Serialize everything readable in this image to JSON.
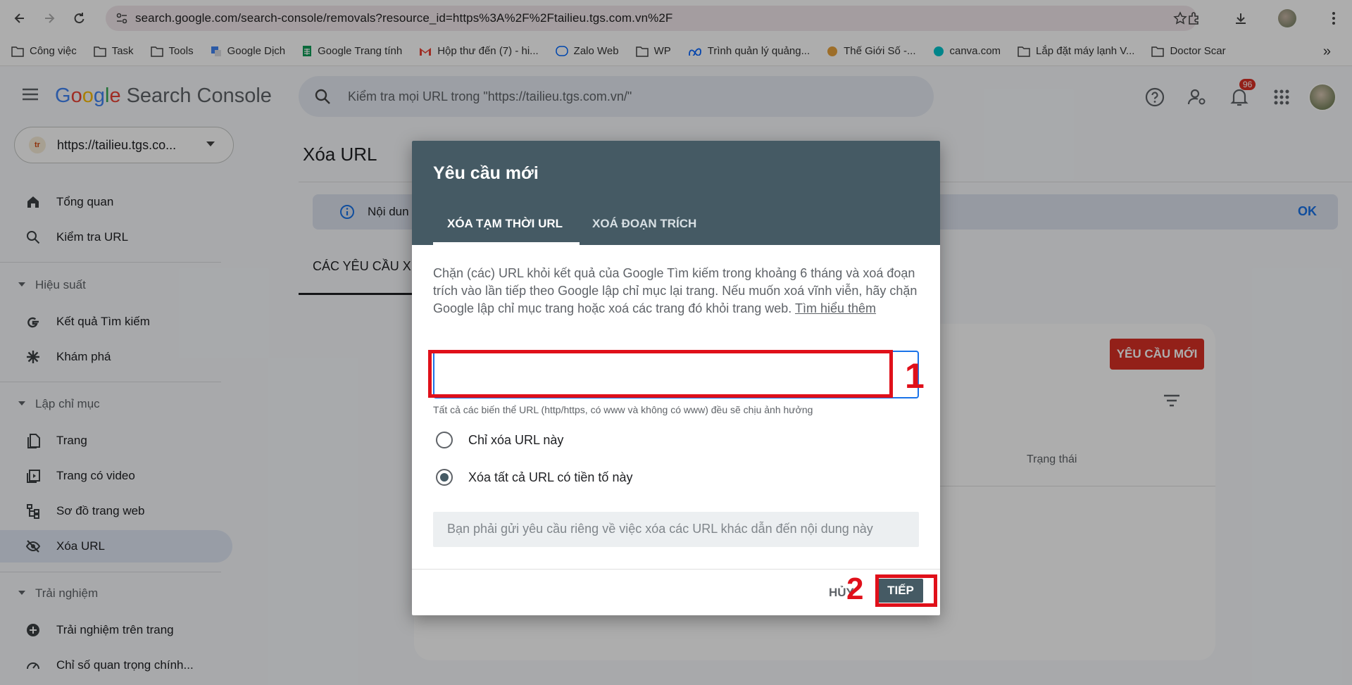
{
  "browser": {
    "url": "search.google.com/search-console/removals?resource_id=https%3A%2F%2Ftailieu.tgs.com.vn%2F",
    "bookmarks": [
      {
        "label": "Công việc",
        "icon": "folder-icon"
      },
      {
        "label": "Task",
        "icon": "folder-icon"
      },
      {
        "label": "Tools",
        "icon": "folder-icon"
      },
      {
        "label": "Google Dịch",
        "icon": "google-translate-icon"
      },
      {
        "label": "Google Trang tính",
        "icon": "google-sheets-icon"
      },
      {
        "label": "Hộp thư đến (7) - hi...",
        "icon": "gmail-icon"
      },
      {
        "label": "Zalo Web",
        "icon": "zalo-icon"
      },
      {
        "label": "WP",
        "icon": "folder-icon"
      },
      {
        "label": "Trình quản lý quảng...",
        "icon": "meta-icon"
      },
      {
        "label": "Thế Giới Số -...",
        "icon": "site-icon"
      },
      {
        "label": "canva.com",
        "icon": "canva-icon"
      },
      {
        "label": "Lắp đặt máy lạnh V...",
        "icon": "folder-icon"
      },
      {
        "label": "Doctor Scar",
        "icon": "folder-icon"
      }
    ],
    "more": "»"
  },
  "app": {
    "logo_google": [
      "G",
      "o",
      "o",
      "g",
      "l",
      "e"
    ],
    "logo_product": "Search Console",
    "search_placeholder": "Kiểm tra mọi URL trong \"https://tailieu.tgs.com.vn/\"",
    "notification_count": "96"
  },
  "sidebar": {
    "property": "https://tailieu.tgs.co...",
    "items": {
      "overview": "Tổng quan",
      "url_inspection": "Kiểm tra URL",
      "performance_section": "Hiệu suất",
      "search_results": "Kết quả Tìm kiếm",
      "discover": "Khám phá",
      "indexing_section": "Lập chỉ mục",
      "pages": "Trang",
      "video_pages": "Trang có video",
      "sitemaps": "Sơ đồ trang web",
      "removals": "Xóa URL",
      "experience_section": "Trải nghiệm",
      "page_experience": "Trải nghiệm trên trang",
      "core_web_vitals": "Chỉ số quan trọng chính..."
    }
  },
  "main": {
    "title": "Xóa URL",
    "info_text": "Nội dun",
    "info_ok": "OK",
    "requests_tab": "CÁC YÊU CẦU X",
    "new_request": "YÊU CẦU MỚI",
    "status_header": "Trạng thái"
  },
  "dialog": {
    "title": "Yêu cầu mới",
    "tab_temp": "XÓA TẠM THỜI URL",
    "tab_snippet": "XOÁ ĐOẠN TRÍCH",
    "description": "Chặn (các) URL khỏi kết quả của Google Tìm kiếm trong khoảng 6 tháng và xoá đoạn trích vào lần tiếp theo Google lập chỉ mục lại trang. Nếu muốn xoá vĩnh viễn, hãy chặn Google lập chỉ mục trang hoặc xoá các trang đó khỏi trang web.",
    "learn_more": "Tìm hiểu thêm",
    "url_value": "",
    "hint": "Tất cả các biến thể URL (http/https, có www và không có www) đều sẽ chịu ảnh hưởng",
    "option_this_url": "Chỉ xóa URL này",
    "option_prefix": "Xóa tất cả URL có tiền tố này",
    "selected_option": "option_prefix",
    "note": "Bạn phải gửi yêu cầu riêng về việc xóa các URL khác dẫn đến nội dung này",
    "cancel": "HỦY",
    "next": "TIẾP",
    "annotation_1": "1",
    "annotation_2": "2",
    "annotation_color": "#e0101a"
  }
}
